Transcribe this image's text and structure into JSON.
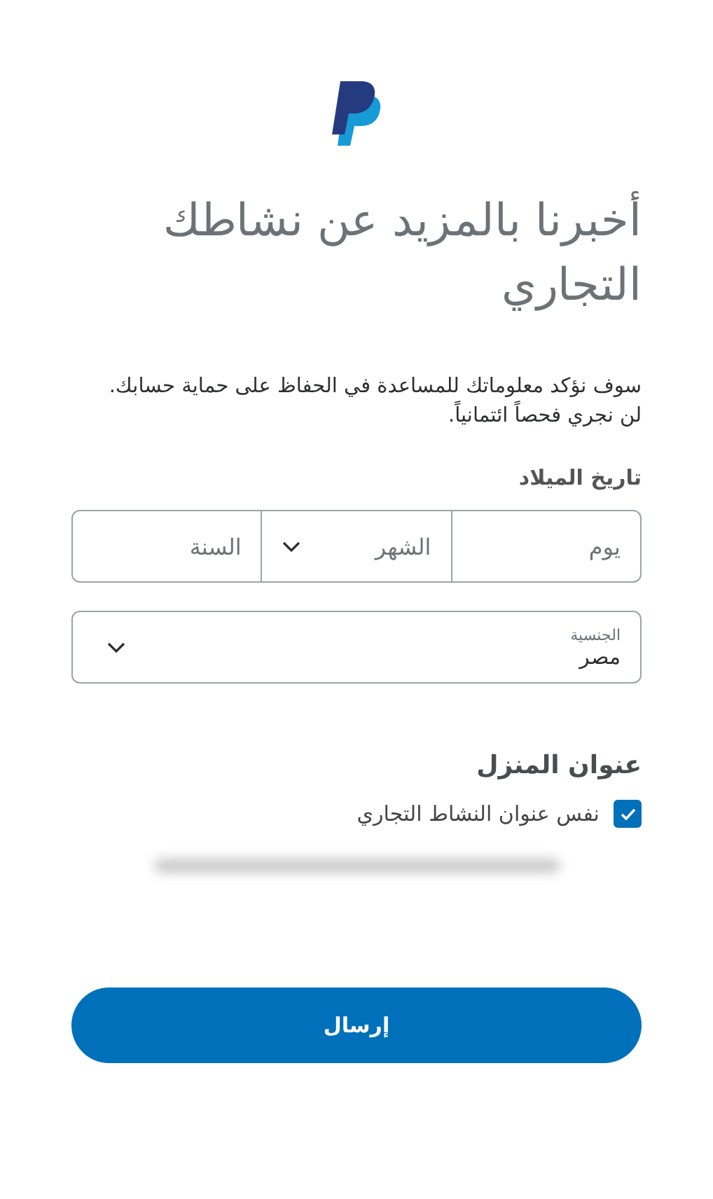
{
  "title": "أخبرنا بالمزيد عن نشاطك التجاري",
  "intro": [
    "سوف نؤكد معلوماتك للمساعدة في الحفاظ على حماية حسابك.",
    "لن نجري فحصاً ائتمانياً."
  ],
  "birth_date": {
    "label": "تاريخ الميلاد",
    "fields": [
      {
        "kind": "text",
        "placeholder": "يوم"
      },
      {
        "kind": "select",
        "placeholder": "الشهر"
      },
      {
        "kind": "text",
        "placeholder": "السنة"
      }
    ]
  },
  "nationality": {
    "label": "الجنسية",
    "value": "مصر"
  },
  "home_address": {
    "heading": "عنوان المنزل",
    "same_as_business": {
      "label": "نفس عنوان النشاط التجاري",
      "checked": true
    }
  },
  "submit_button": "إرسال"
}
